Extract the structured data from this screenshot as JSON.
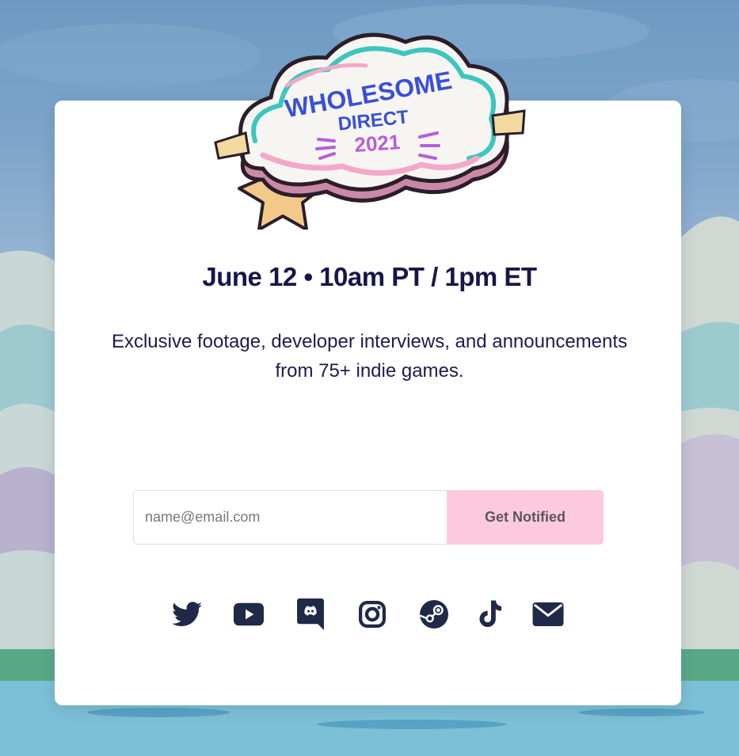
{
  "event": {
    "logo_text_line1": "WHOLESOME",
    "logo_text_line2": "DIRECT",
    "logo_text_line3": "2021",
    "headline": "June 12 • 10am PT / 1pm ET",
    "subtitle": "Exclusive footage, developer interviews, and announcements from 75+ indie games."
  },
  "signup": {
    "email_placeholder": "name@email.com",
    "email_value": "",
    "submit_label": "Get Notified"
  },
  "socials": [
    {
      "icon": "twitter-icon"
    },
    {
      "icon": "youtube-icon"
    },
    {
      "icon": "discord-icon"
    },
    {
      "icon": "instagram-icon"
    },
    {
      "icon": "steam-icon"
    },
    {
      "icon": "tiktok-icon"
    },
    {
      "icon": "email-icon"
    }
  ],
  "colors": {
    "text_dark": "#16164a",
    "button_bg": "#fdcadd",
    "icon_color": "#1f2a48",
    "logo_pink": "#f4a8c8",
    "logo_teal": "#3cc6c0",
    "logo_blue_text": "#3a4fd8",
    "logo_purple_text": "#b65fd6"
  }
}
